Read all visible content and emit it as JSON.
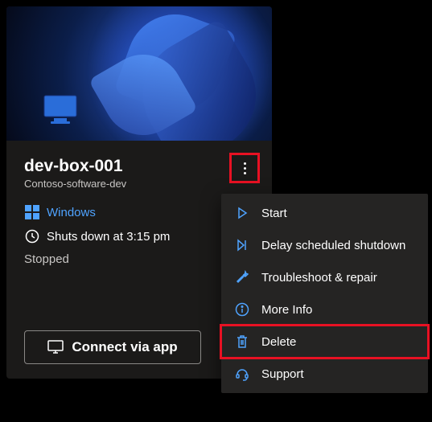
{
  "card": {
    "title": "dev-box-001",
    "subtitle": "Contoso-software-dev",
    "os_label": "Windows",
    "shutdown_text": "Shuts down at 3:15 pm",
    "status": "Stopped",
    "connect_label": "Connect via app"
  },
  "menu": {
    "items": [
      {
        "label": "Start"
      },
      {
        "label": "Delay scheduled shutdown"
      },
      {
        "label": "Troubleshoot & repair"
      },
      {
        "label": "More Info"
      },
      {
        "label": "Delete"
      },
      {
        "label": "Support"
      }
    ]
  },
  "colors": {
    "accent": "#4fa3ff",
    "highlight": "#e81123"
  }
}
